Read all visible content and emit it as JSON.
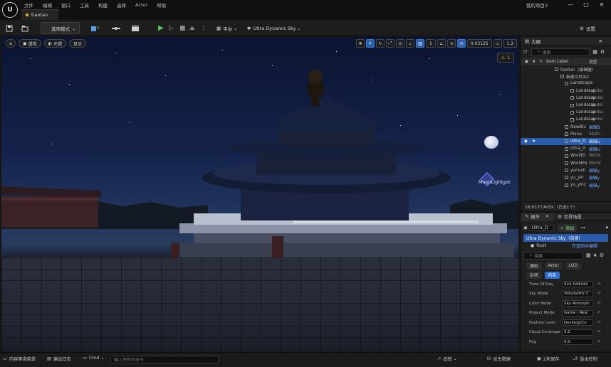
{
  "app": {
    "logo_text": "U",
    "project_name": "我的项目3",
    "menu": [
      "文件",
      "编辑",
      "窗口",
      "工具",
      "构建",
      "选择",
      "Actor",
      "帮助"
    ],
    "document_tab": "tiantan",
    "window_controls": [
      "—",
      "□",
      "✕"
    ]
  },
  "toolbar": {
    "mode_select": "选项模式",
    "platform_label": "平台",
    "sky_label": "Ultra Dynamic Sky",
    "settings_label": "设置"
  },
  "viewport": {
    "left_pills": [
      "透视",
      "光照",
      "显示"
    ],
    "camera_speed": "0.03125",
    "grid_value": "1",
    "scale_value": "1.2",
    "warning_count": "1",
    "light_label": "MoonLightgot"
  },
  "outliner": {
    "tab_label": "大纲",
    "search_placeholder": "搜索",
    "column_label": "Item Label",
    "column_type": "类型",
    "rows": [
      {
        "label": "tiantan（编辑器）",
        "type": "",
        "indent": 48,
        "selected": false,
        "type_blue": false
      },
      {
        "label": "新建文件夹1",
        "type": "",
        "indent": 56,
        "selected": false,
        "type_blue": false
      },
      {
        "label": "Landscape",
        "type": "",
        "indent": 62,
        "selected": false,
        "type_blue": false
      },
      {
        "label": "Landscap",
        "type": "Landsc",
        "indent": 70,
        "selected": false,
        "type_blue": false
      },
      {
        "label": "Landscap",
        "type": "Landsc",
        "indent": 70,
        "selected": false,
        "type_blue": false
      },
      {
        "label": "Landscap",
        "type": "Landsc",
        "indent": 70,
        "selected": false,
        "type_blue": false
      },
      {
        "label": "Landscap",
        "type": "Landsc",
        "indent": 70,
        "selected": false,
        "type_blue": false
      },
      {
        "label": "Landscap",
        "type": "Landsc",
        "indent": 70,
        "selected": false,
        "type_blue": false
      },
      {
        "label": "NewBlu",
        "type": "编辑B",
        "indent": 62,
        "selected": false,
        "type_blue": true
      },
      {
        "label": "Plane",
        "type": "Static",
        "indent": 62,
        "selected": false,
        "type_blue": false
      },
      {
        "label": "Ultra_D",
        "type": "编辑U",
        "indent": 62,
        "selected": true,
        "type_blue": true
      },
      {
        "label": "Ultra_D",
        "type": "编辑U",
        "indent": 62,
        "selected": false,
        "type_blue": true
      },
      {
        "label": "WorldD",
        "type": "World",
        "indent": 62,
        "selected": false,
        "type_blue": false
      },
      {
        "label": "WorldPa",
        "type": "World",
        "indent": 62,
        "selected": false,
        "type_blue": false
      },
      {
        "label": "yunush",
        "type": "编辑y",
        "indent": 62,
        "selected": false,
        "type_blue": true
      },
      {
        "label": "yu_yin",
        "type": "编辑y",
        "indent": 62,
        "selected": false,
        "type_blue": true
      },
      {
        "label": "yu_yinz",
        "type": "编辑y",
        "indent": 62,
        "selected": false,
        "type_blue": true
      }
    ],
    "footer": "16,613个Actor（已选1个）"
  },
  "details": {
    "tabs": [
      "细节",
      "世界场景"
    ],
    "actor_name": "Ultra_D",
    "add_label": "+ 添加",
    "component_root": "Ultra Dynamic Sky（自身）",
    "component_child": "Root",
    "component_child_type": "在蓝图中编辑",
    "search_placeholder": "搜索",
    "filters_row1": [
      "通用",
      "Actor",
      "LOD"
    ],
    "filters_row2": [
      "杂项",
      "所有"
    ],
    "props": [
      {
        "label": "Time Of Day",
        "value": "924.544444"
      },
      {
        "label": "Sky Mode",
        "value": "Volumetric C"
      },
      {
        "label": "Color Mode",
        "value": "Sky Atmosph"
      },
      {
        "label": "Project Mode",
        "value": "Game / Real"
      },
      {
        "label": "Feature Level",
        "value": "Desktop/Co"
      },
      {
        "label": "Cloud Coverage",
        "value": "3.0"
      },
      {
        "label": "Fog",
        "value": "0.0"
      }
    ]
  },
  "statusbar": {
    "content_drawer": "内容侧滑菜单",
    "output_log": "输出日志",
    "cmd_label": "Cmd",
    "cmd_placeholder": "输入控制台命令",
    "trace_label": "追踪",
    "derived_data": "派生数据",
    "save_label": "2未保存",
    "source_control": "版本控制"
  }
}
